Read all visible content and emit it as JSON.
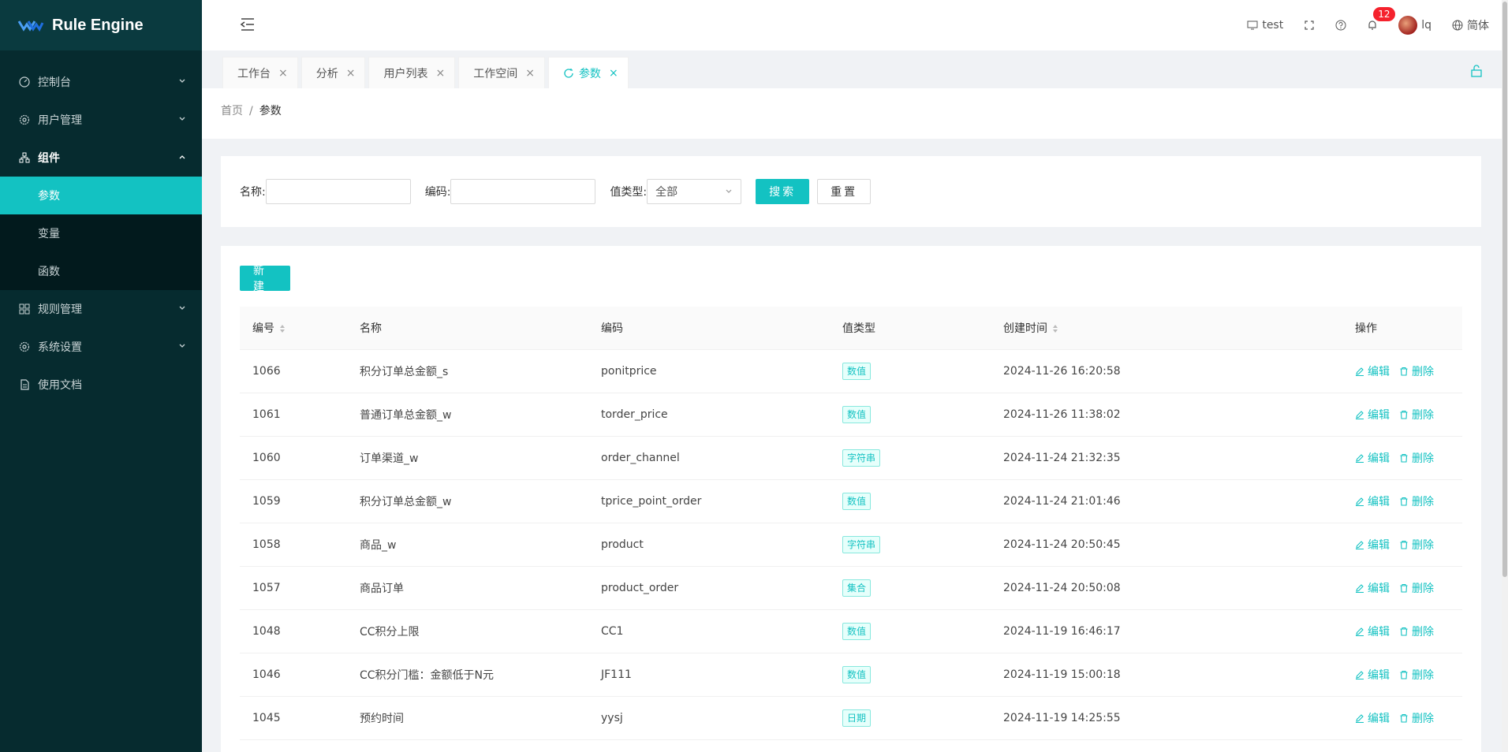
{
  "app": {
    "name": "Rule Engine"
  },
  "sidebar": {
    "items": [
      {
        "label": "控制台",
        "icon": "dashboard-icon"
      },
      {
        "label": "用户管理",
        "icon": "gear-icon"
      },
      {
        "label": "组件",
        "icon": "cluster-icon",
        "open": true,
        "children": [
          {
            "label": "参数",
            "active": true
          },
          {
            "label": "变量"
          },
          {
            "label": "函数"
          }
        ]
      },
      {
        "label": "规则管理",
        "icon": "grid-icon"
      },
      {
        "label": "系统设置",
        "icon": "gear-icon"
      },
      {
        "label": "使用文档",
        "icon": "file-icon"
      }
    ]
  },
  "header": {
    "env": "test",
    "notifications": "12",
    "user": "lq",
    "lang": "简体"
  },
  "tabs": [
    {
      "label": "工作台"
    },
    {
      "label": "分析"
    },
    {
      "label": "用户列表"
    },
    {
      "label": "工作空间"
    },
    {
      "label": "参数",
      "active": true
    }
  ],
  "breadcrumb": {
    "home": "首页",
    "sep": "/",
    "current": "参数"
  },
  "search": {
    "name_label": "名称:",
    "code_label": "编码:",
    "type_label": "值类型:",
    "type_value": "全部",
    "search_btn": "搜索",
    "reset_btn": "重置"
  },
  "toolbar": {
    "new_btn": "新建"
  },
  "table": {
    "columns": [
      "编号",
      "名称",
      "编码",
      "值类型",
      "创建时间",
      "操作"
    ],
    "edit_label": "编辑",
    "delete_label": "删除",
    "rows": [
      {
        "id": "1066",
        "name": "积分订单总金额_s",
        "code": "ponitprice",
        "type": "数值",
        "time": "2024-11-26 16:20:58"
      },
      {
        "id": "1061",
        "name": "普通订单总金额_w",
        "code": "torder_price",
        "type": "数值",
        "time": "2024-11-26 11:38:02"
      },
      {
        "id": "1060",
        "name": "订单渠道_w",
        "code": "order_channel",
        "type": "字符串",
        "time": "2024-11-24 21:32:35"
      },
      {
        "id": "1059",
        "name": "积分订单总金额_w",
        "code": "tprice_point_order",
        "type": "数值",
        "time": "2024-11-24 21:01:46"
      },
      {
        "id": "1058",
        "name": "商品_w",
        "code": "product",
        "type": "字符串",
        "time": "2024-11-24 20:50:45"
      },
      {
        "id": "1057",
        "name": "商品订单",
        "code": "product_order",
        "type": "集合",
        "time": "2024-11-24 20:50:08"
      },
      {
        "id": "1048",
        "name": "CC积分上限",
        "code": "CC1",
        "type": "数值",
        "time": "2024-11-19 16:46:17"
      },
      {
        "id": "1046",
        "name": "CC积分门槛：金额低于N元",
        "code": "JF111",
        "type": "数值",
        "time": "2024-11-19 15:00:18"
      },
      {
        "id": "1045",
        "name": "预约时间",
        "code": "yysj",
        "type": "日期",
        "time": "2024-11-19 14:25:55"
      }
    ]
  },
  "colors": {
    "accent": "#13c2c2",
    "sidebar_bg": "#062b2f",
    "badge": "#f5222d"
  }
}
